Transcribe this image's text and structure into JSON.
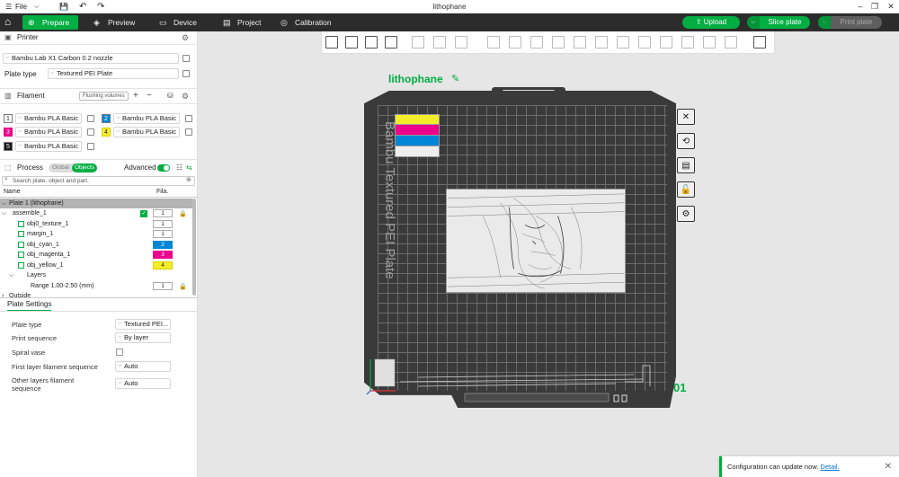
{
  "app": {
    "file_menu": "File",
    "window_title": "lithophane"
  },
  "nav": {
    "tabs": [
      {
        "label": "Prepare"
      },
      {
        "label": "Preview"
      },
      {
        "label": "Device"
      },
      {
        "label": "Project"
      },
      {
        "label": "Calibration"
      }
    ],
    "upload": "Upload",
    "slice": "Slice plate",
    "print": "Print plate"
  },
  "printer": {
    "section": "Printer",
    "name": "Bambu Lab X1 Carbon 0.2 nozzle",
    "plate_label": "Plate type",
    "plate_value": "Textured PEI Plate"
  },
  "filament": {
    "section": "Filament",
    "flushing": "Flushing volumes",
    "items": [
      {
        "num": "1",
        "name": "Bambu PLA Basic",
        "color": "#ffffff"
      },
      {
        "num": "2",
        "name": "Bambu PLA Basic",
        "color": "#0086d6"
      },
      {
        "num": "3",
        "name": "Bambu PLA Basic",
        "color": "#ec008c"
      },
      {
        "num": "4",
        "name": "Bambu PLA Basic",
        "color": "#f4ee2a"
      },
      {
        "num": "5",
        "name": "Bambu PLA Basic",
        "color": "#161616"
      }
    ]
  },
  "process": {
    "section": "Process",
    "global": "Global",
    "objects": "Objects",
    "advanced": "Advanced",
    "search_placeholder": "Search plate, object and part."
  },
  "tree": {
    "col_name": "Name",
    "col_fil": "Fila.",
    "plate": "Plate 1 (lithophane)",
    "rows": [
      {
        "name": "assemble_1",
        "fil": "1"
      },
      {
        "name": "obj0_texture_1",
        "fil": "1"
      },
      {
        "name": "margin_1",
        "fil": "1"
      },
      {
        "name": "obj_cyan_1",
        "fil": "2"
      },
      {
        "name": "obj_magenta_1",
        "fil": "3"
      },
      {
        "name": "obj_yellow_1",
        "fil": "4"
      },
      {
        "name": "Layers",
        "fil": ""
      },
      {
        "name": "Range 1.00-2.50 (mm)",
        "fil": "1"
      },
      {
        "name": "Outside",
        "fil": ""
      }
    ]
  },
  "plate_settings": {
    "title": "Plate Settings",
    "rows": [
      {
        "label": "Plate type",
        "value": "Textured PEI..."
      },
      {
        "label": "Print sequence",
        "value": "By layer"
      },
      {
        "label": "Spiral vase",
        "value": ""
      },
      {
        "label": "First layer filament sequence",
        "value": "Auto"
      },
      {
        "label": "Other layers filament sequence",
        "value": "Auto"
      }
    ]
  },
  "canvas": {
    "plate_name": "lithophane",
    "bed_text": "Bambu Textured PEI Plate",
    "plate_number": "01"
  },
  "notification": {
    "text": "Configuration can update now.",
    "link": "Detail."
  }
}
